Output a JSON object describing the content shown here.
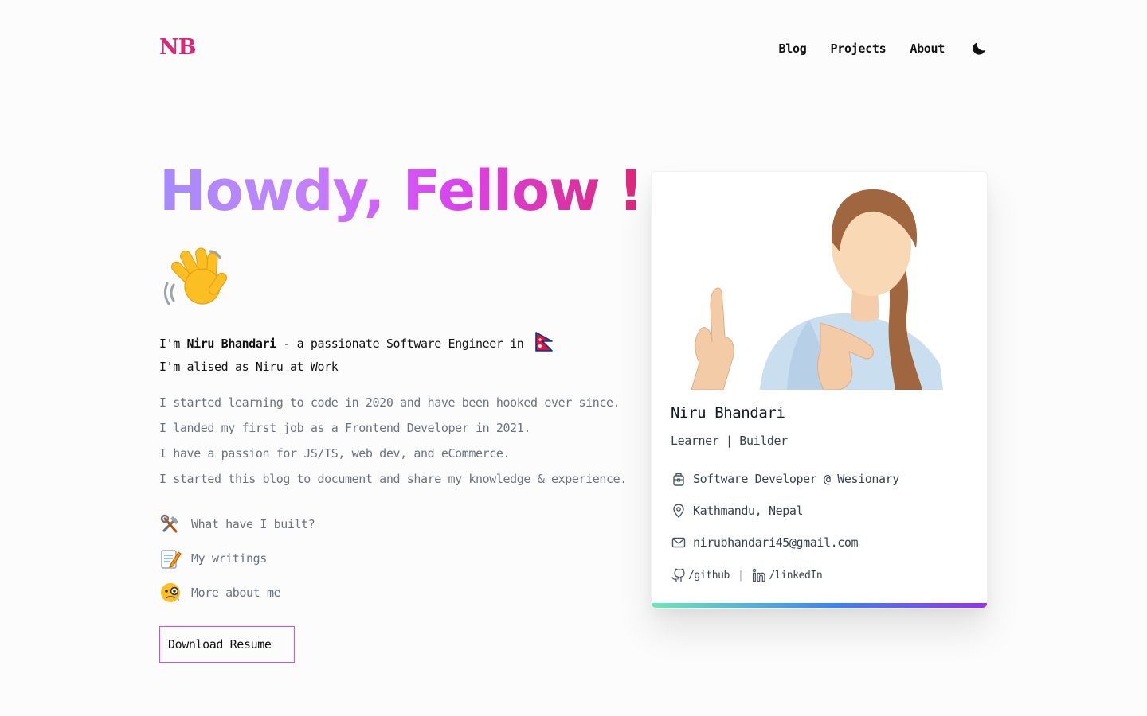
{
  "header": {
    "logo": "NB",
    "nav": [
      {
        "label": "Blog"
      },
      {
        "label": "Projects"
      },
      {
        "label": "About"
      }
    ],
    "theme_toggle_icon": "moon-icon"
  },
  "hero": {
    "title": "Howdy, Fellow !",
    "wave_icon": "waving-hand-icon",
    "intro": {
      "prefix": "I'm ",
      "name": "Niru Bhandari",
      "suffix": " - a passionate Software Engineer in",
      "flag_icon": "nepal-flag-icon",
      "line2": "I'm alised as Niru at Work"
    },
    "bio": [
      "I started learning to code in 2020 and have been hooked ever since.",
      "I landed my first job as a Frontend Developer in 2021.",
      "I have a passion for JS/TS, web dev, and eCommerce.",
      "I started this blog to document and share my knowledge & experience."
    ],
    "links": [
      {
        "icon": "tools-icon",
        "label": "What have I built?"
      },
      {
        "icon": "memo-icon",
        "label": "My writings"
      },
      {
        "icon": "monocle-face-icon",
        "label": "More about me"
      }
    ],
    "resume_button": "Download Resume"
  },
  "profile_card": {
    "name": "Niru Bhandari",
    "tagline": "Learner | Builder",
    "job": "Software Developer @ Wesionary",
    "location": "Kathmandu, Nepal",
    "email": "nirubhandari45@gmail.com",
    "github_label": "/github",
    "linkedin_label": "/linkedIn",
    "accent_gradient": [
      "#6ee7b7",
      "#3b82f6",
      "#9333ea"
    ]
  },
  "colors": {
    "brand": "#db2777",
    "title_gradient": [
      "#a78bfa",
      "#c084fc",
      "#d946ef",
      "#db2777"
    ],
    "body_text": "#6b7280"
  }
}
